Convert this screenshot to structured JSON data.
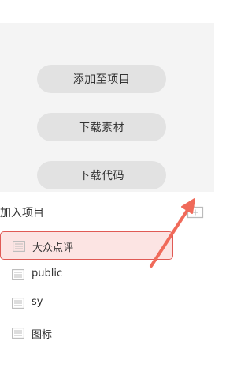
{
  "actions": {
    "add_to_project": "添加至项目",
    "download_assets": "下载素材",
    "download_code": "下载代码"
  },
  "section": {
    "title": "加入项目"
  },
  "projects": [
    {
      "label": "大众点评",
      "selected": true
    },
    {
      "label": "public",
      "selected": false
    },
    {
      "label": "sy",
      "selected": false
    },
    {
      "label": "图标",
      "selected": false
    }
  ],
  "colors": {
    "panel_bg": "#f4f4f4",
    "button_bg": "#e2e2e2",
    "selected_bg": "#fce4e3",
    "selected_border": "#e05a55",
    "arrow": "#f06a5a",
    "icon": "#bbbbbb"
  },
  "icons": {
    "add_folder": "folder-plus-icon",
    "project": "folder-icon",
    "annotation": "arrow-pointer"
  }
}
